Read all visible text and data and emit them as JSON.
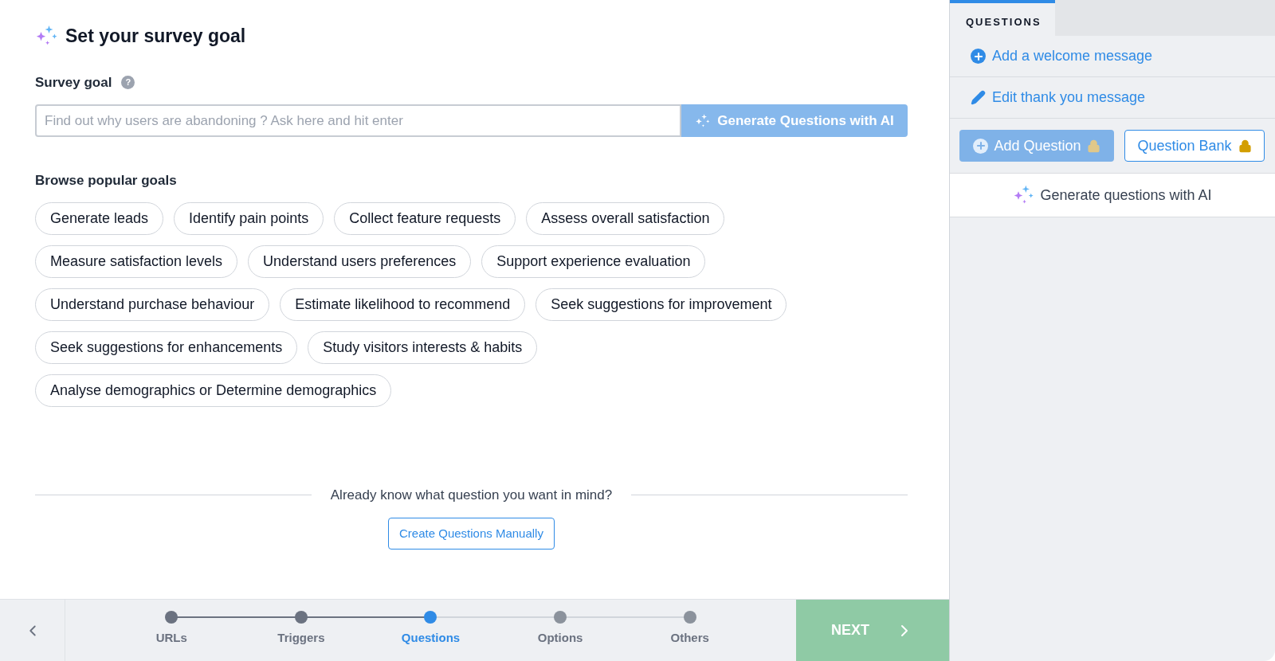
{
  "main": {
    "title": "Set your survey goal",
    "goal_label": "Survey goal",
    "help_icon": "?",
    "goal_input": {
      "placeholder": "Find out why users are abandoning ? Ask here and hit enter"
    },
    "generate_button": {
      "label": "Generate Questions with AI",
      "disabled": true
    },
    "browse_title": "Browse popular goals",
    "goals": [
      [
        "Generate leads",
        "Identify pain points",
        "Collect feature requests",
        "Assess overall satisfaction"
      ],
      [
        "Measure satisfaction levels",
        "Understand users preferences",
        "Support experience evaluation"
      ],
      [
        "Understand purchase behaviour",
        "Estimate likelihood to recommend",
        "Seek suggestions for improvement"
      ],
      [
        "Seek suggestions for enhancements",
        "Study visitors interests & habits"
      ],
      [
        "Analyse demographics or Determine demographics"
      ]
    ],
    "manual_prompt": "Already know what question you want in mind?",
    "manual_button": "Create Questions Manually"
  },
  "footer": {
    "steps": [
      {
        "label": "URLs",
        "done": true,
        "selected": false
      },
      {
        "label": "Triggers",
        "done": true,
        "selected": false
      },
      {
        "label": "Questions",
        "done": false,
        "selected": true
      },
      {
        "label": "Options",
        "done": false,
        "selected": false
      },
      {
        "label": "Others",
        "done": false,
        "selected": false
      }
    ],
    "next": {
      "label": "NEXT",
      "disabled": true
    }
  },
  "sidebar": {
    "tab": {
      "label": "QUESTIONS",
      "selected": true
    },
    "links": [
      {
        "kind": "plus",
        "label": "Add a welcome message"
      },
      {
        "kind": "pencil",
        "label": "Edit thank you message"
      }
    ],
    "add_question": {
      "label": "Add Question",
      "disabled": true,
      "locked": true
    },
    "question_bank": {
      "label": "Question Bank",
      "locked": true
    },
    "ai_link": "Generate questions with AI"
  }
}
